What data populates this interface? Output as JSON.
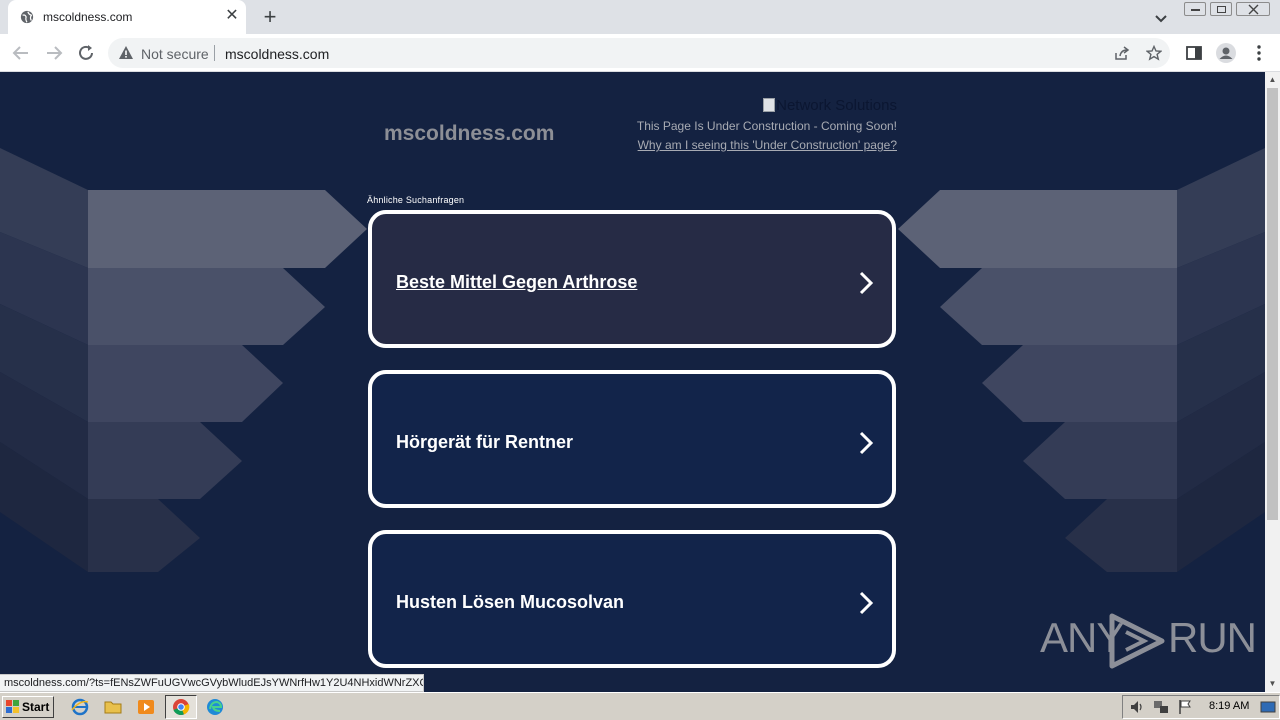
{
  "browser": {
    "tab_title": "mscoldness.com",
    "security_label": "Not secure",
    "url": "mscoldness.com"
  },
  "page": {
    "domain_title": "mscoldness.com",
    "logo_alt": "Network Solutions",
    "under_construction": "This Page Is Under Construction - Coming Soon!",
    "why_link": "Why am I seeing this 'Under Construction' page?",
    "related_label": "Ähnliche Suchanfragen",
    "cards": [
      {
        "label": "Beste Mittel Gegen Arthrose"
      },
      {
        "label": "Hörgerät für Rentner"
      },
      {
        "label": "Husten Lösen Mucosolvan"
      }
    ],
    "colors": {
      "background": "#142241",
      "card_first": "#262b45",
      "card_other": "#12244a"
    }
  },
  "status_url": "mscoldness.com/?ts=fENsZWFuUGVwcGVybWludEJsYWNrfHw1Y2U4NHxidWNrZXQw...",
  "watermark": {
    "left": "ANY",
    "right": "RUN"
  },
  "taskbar": {
    "start_label": "Start",
    "clock": "8:19 AM"
  }
}
